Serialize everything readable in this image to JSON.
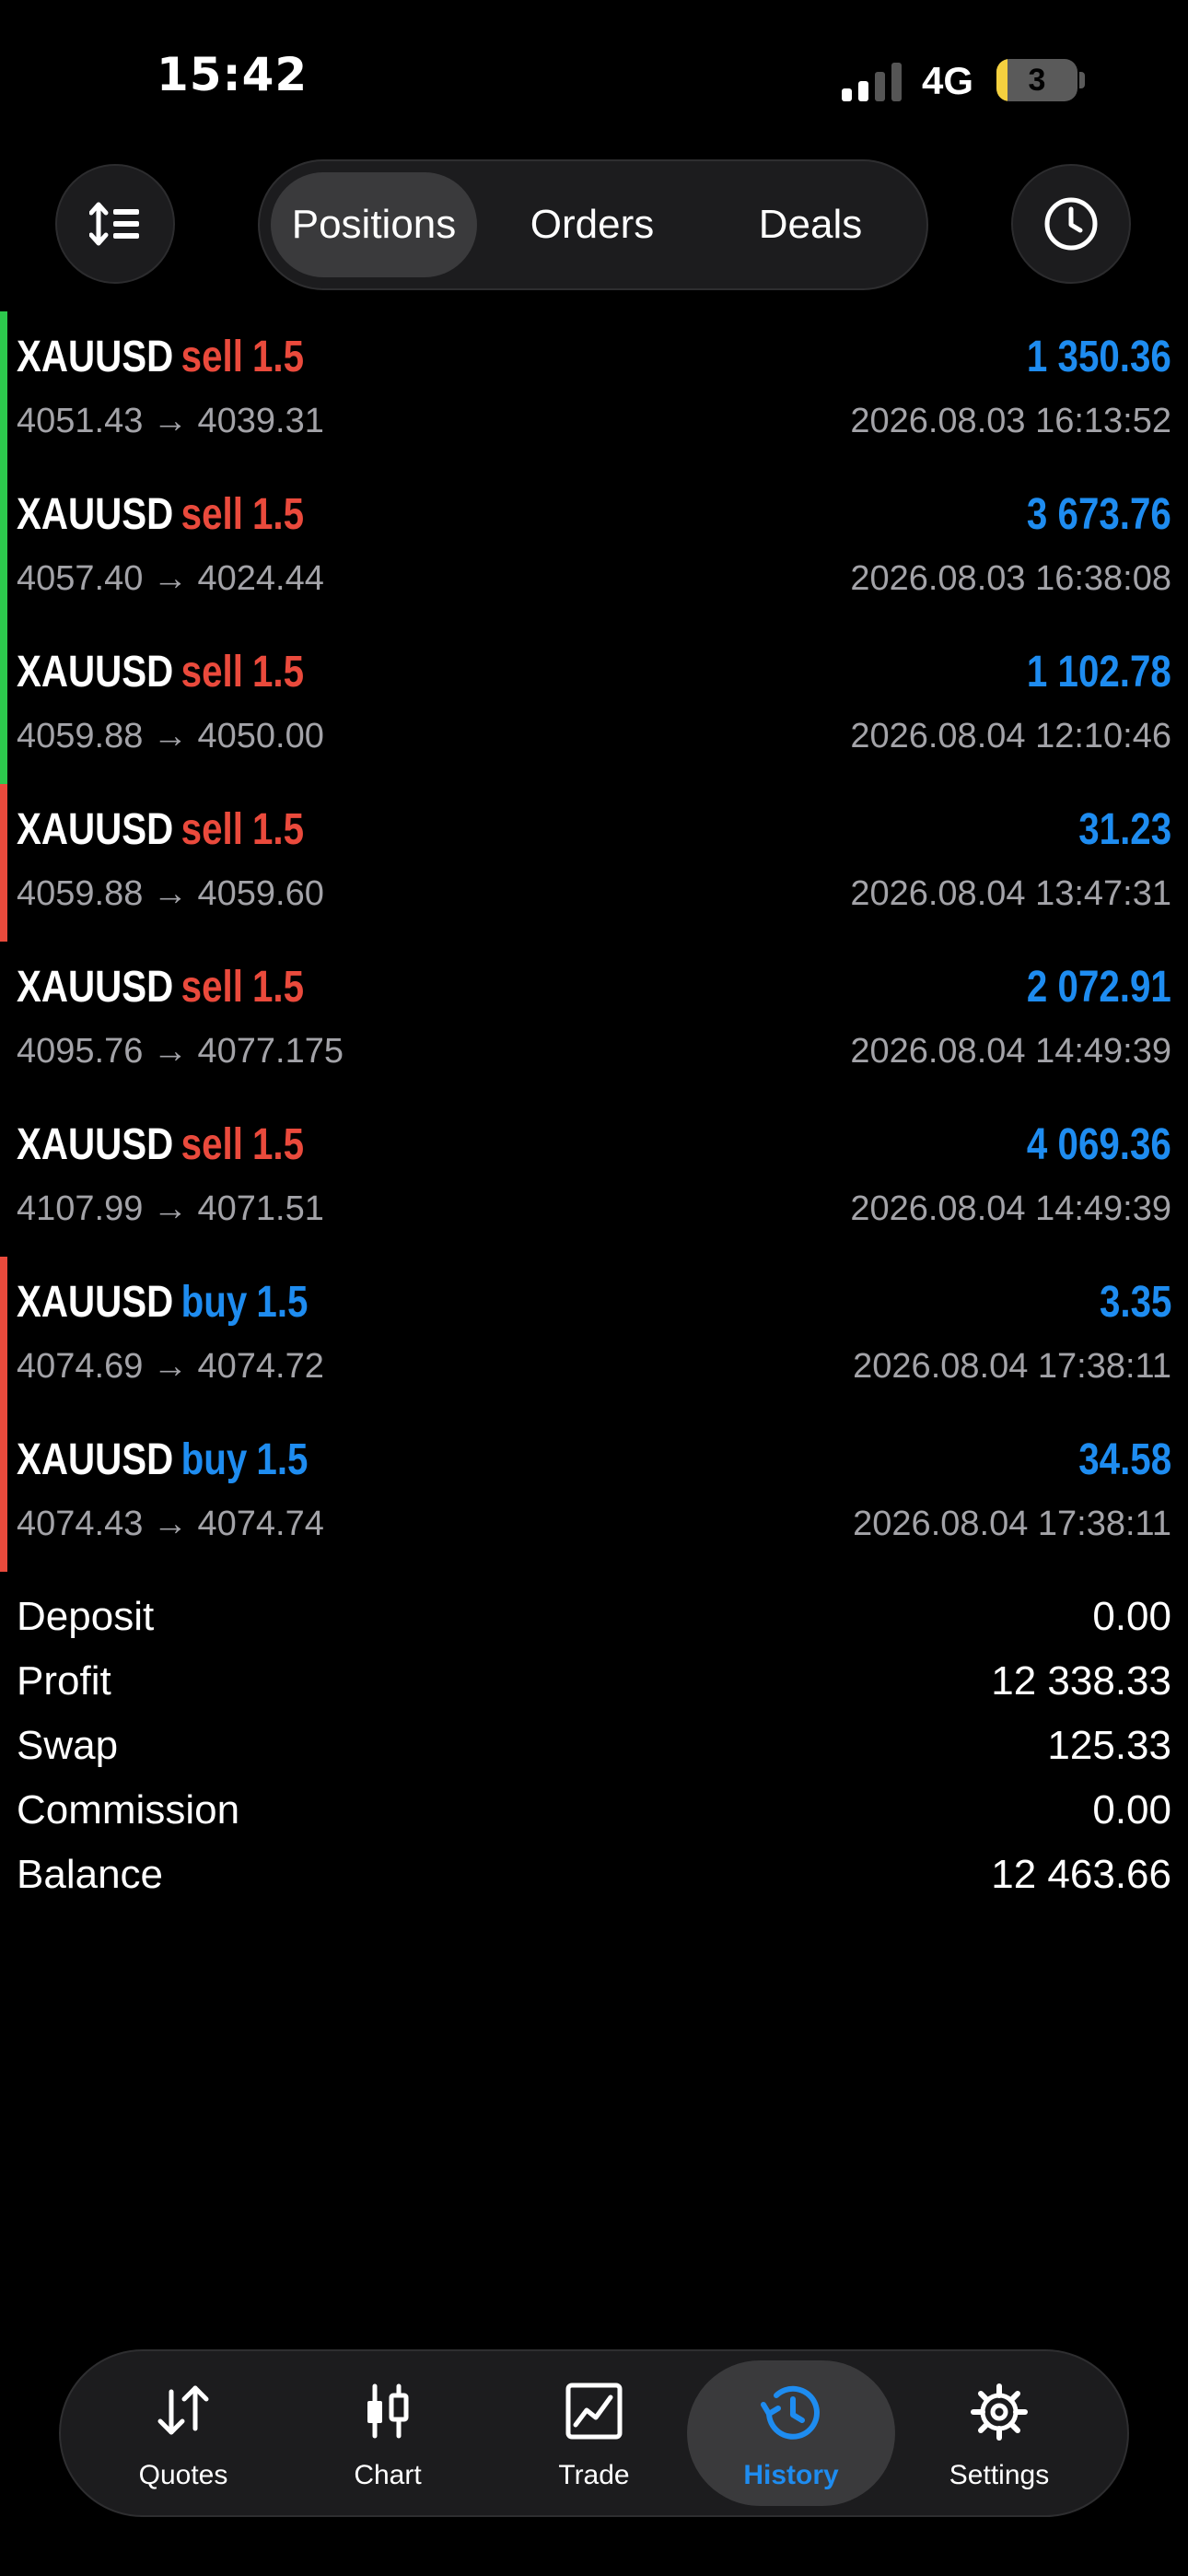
{
  "status_bar": {
    "time": "15:42",
    "network": "4G",
    "battery_level": "3"
  },
  "toolbar": {
    "tabs": [
      {
        "label": "Positions",
        "active": true
      },
      {
        "label": "Orders",
        "active": false
      },
      {
        "label": "Deals",
        "active": false
      }
    ]
  },
  "colors": {
    "profit_blue": "#1e8cf0",
    "sell_red": "#ea4a3c",
    "accent_green": "#2dc84d",
    "accent_red": "#ea4a3c"
  },
  "positions": [
    {
      "symbol": "XAUUSD",
      "side": "sell",
      "volume": "1.5",
      "prices": "4051.43 → 4039.31",
      "profit": "1 350.36",
      "time": "2026.08.03 16:13:52",
      "accent": "green"
    },
    {
      "symbol": "XAUUSD",
      "side": "sell",
      "volume": "1.5",
      "prices": "4057.40 → 4024.44",
      "profit": "3 673.76",
      "time": "2026.08.03 16:38:08",
      "accent": "green"
    },
    {
      "symbol": "XAUUSD",
      "side": "sell",
      "volume": "1.5",
      "prices": "4059.88 → 4050.00",
      "profit": "1 102.78",
      "time": "2026.08.04 12:10:46",
      "accent": "green"
    },
    {
      "symbol": "XAUUSD",
      "side": "sell",
      "volume": "1.5",
      "prices": "4059.88 → 4059.60",
      "profit": "31.23",
      "time": "2026.08.04 13:47:31",
      "accent": "red"
    },
    {
      "symbol": "XAUUSD",
      "side": "sell",
      "volume": "1.5",
      "prices": "4095.76 → 4077.175",
      "profit": "2 072.91",
      "time": "2026.08.04 14:49:39",
      "accent": "none"
    },
    {
      "symbol": "XAUUSD",
      "side": "sell",
      "volume": "1.5",
      "prices": "4107.99 → 4071.51",
      "profit": "4 069.36",
      "time": "2026.08.04 14:49:39",
      "accent": "none"
    },
    {
      "symbol": "XAUUSD",
      "side": "buy",
      "volume": "1.5",
      "prices": "4074.69 → 4074.72",
      "profit": "3.35",
      "time": "2026.08.04 17:38:11",
      "accent": "red"
    },
    {
      "symbol": "XAUUSD",
      "side": "buy",
      "volume": "1.5",
      "prices": "4074.43 → 4074.74",
      "profit": "34.58",
      "time": "2026.08.04 17:38:11",
      "accent": "red"
    }
  ],
  "summary": [
    {
      "label": "Deposit",
      "value": "0.00"
    },
    {
      "label": "Profit",
      "value": "12 338.33"
    },
    {
      "label": "Swap",
      "value": "125.33"
    },
    {
      "label": "Commission",
      "value": "0.00"
    },
    {
      "label": "Balance",
      "value": "12 463.66"
    }
  ],
  "tabbar": {
    "items": [
      {
        "label": "Quotes",
        "icon": "arrows-up-down-icon",
        "active": false
      },
      {
        "label": "Chart",
        "icon": "candlestick-icon",
        "active": false
      },
      {
        "label": "Trade",
        "icon": "line-chart-icon",
        "active": false
      },
      {
        "label": "History",
        "icon": "history-icon",
        "active": true
      },
      {
        "label": "Settings",
        "icon": "gear-icon",
        "active": false
      }
    ]
  }
}
